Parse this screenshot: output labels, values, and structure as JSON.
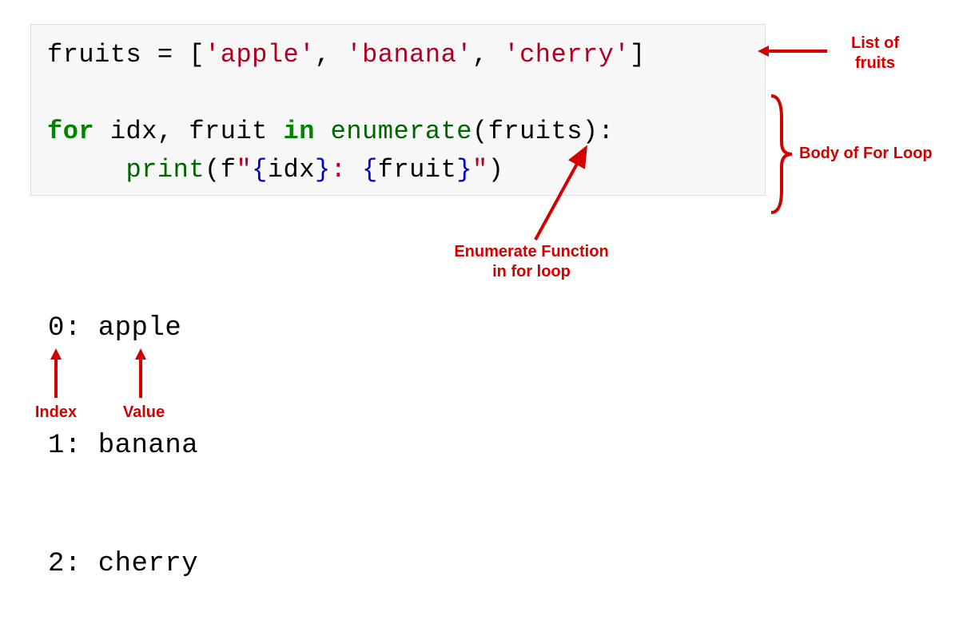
{
  "code": {
    "line1": {
      "var": "fruits",
      "eq": " = ",
      "lb": "[",
      "s1": "'apple'",
      "c1": ", ",
      "s2": "'banana'",
      "c2": ", ",
      "s3": "'cherry'",
      "rb": "]"
    },
    "line3": {
      "kw_for": "for",
      "vars": " idx, fruit ",
      "kw_in": "in",
      "sp": " ",
      "func": "enumerate",
      "call": "(fruits):"
    },
    "line4": {
      "indent": "     ",
      "pfunc": "print",
      "lp": "(f",
      "fstr_open": "\"",
      "lb1": "{",
      "v1": "idx",
      "rb1": "}",
      "colon": ": ",
      "lb2": "{",
      "v2": "fruit",
      "rb2": "}",
      "fstr_close": "\"",
      "rp": ")"
    }
  },
  "output": {
    "l1": "0: apple",
    "l2": "1: banana",
    "l3": "2: cherry"
  },
  "annot": {
    "list_fruits_l1": "List of",
    "list_fruits_l2": "fruits",
    "body_loop": "Body of For Loop",
    "enum_l1": "Enumerate Function",
    "enum_l2": "in for loop",
    "index": "Index",
    "value": "Value"
  }
}
